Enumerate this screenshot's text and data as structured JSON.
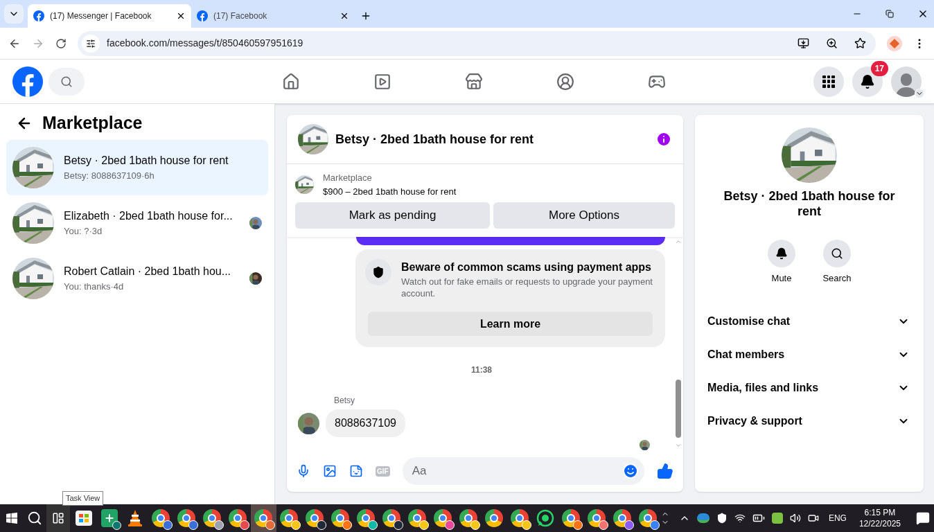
{
  "browser": {
    "tabs": [
      {
        "title": "(17) Messenger | Facebook",
        "selected": true
      },
      {
        "title": "(17) Facebook",
        "selected": false
      }
    ],
    "url": "facebook.com/messages/t/850460597951619"
  },
  "header": {
    "nav": [
      {
        "kind": "home"
      },
      {
        "kind": "video"
      },
      {
        "kind": "marketplace"
      },
      {
        "kind": "groups"
      },
      {
        "kind": "gaming"
      }
    ],
    "notifications_badge": "17"
  },
  "sidebar": {
    "title": "Marketplace",
    "chats": [
      {
        "name": "Betsy · 2bed 1bath house for rent",
        "preview": "Betsy: 8088637109·6h",
        "selected": true,
        "seen": false
      },
      {
        "name": "Elizabeth · 2bed 1bath house for...",
        "preview": "You: ?·3d",
        "selected": false,
        "seen": true
      },
      {
        "name": "Robert Catlain · 2bed 1bath hou...",
        "preview": "You: thanks·4d",
        "selected": false,
        "seen": true
      }
    ]
  },
  "chat": {
    "title": "Betsy · 2bed 1bath house for rent",
    "listing": {
      "label": "Marketplace",
      "text": "$900 – 2bed 1bath house for rent"
    },
    "actions": [
      "Mark as pending",
      "More Options"
    ],
    "notice": {
      "title": "Beware of common scams using payment apps",
      "body": "Watch out for fake emails or requests to upgrade your payment account.",
      "button": "Learn more"
    },
    "timestamp": "11:38",
    "messages": [
      {
        "sender": "Betsy",
        "text": "8088637109"
      }
    ],
    "composer": {
      "gif": "GIF",
      "placeholder": "Aa"
    }
  },
  "details": {
    "title": "Betsy · 2bed 1bath house for rent",
    "actions": [
      {
        "kind": "mute",
        "label": "Mute"
      },
      {
        "kind": "search",
        "label": "Search"
      }
    ],
    "sections": [
      {
        "label": "Customise chat",
        "expanded": false
      },
      {
        "label": "Chat members",
        "expanded": false
      },
      {
        "label": "Media, files and links",
        "expanded": false
      },
      {
        "label": "Privacy & support",
        "expanded": false
      }
    ]
  },
  "taskbar": {
    "tooltip": "Task View",
    "apps": [
      {
        "kind": "store"
      },
      {
        "kind": "sheets"
      },
      {
        "kind": "vlc"
      },
      {
        "kind": "chrome",
        "color": "#3b6fd8",
        "selected": false
      },
      {
        "kind": "chrome",
        "color": "#3b6fd8",
        "selected": false
      },
      {
        "kind": "chrome",
        "color": "#9ca3af",
        "selected": false
      },
      {
        "kind": "chrome",
        "color": "#e5484d",
        "selected": false
      },
      {
        "kind": "chrome",
        "color": "#e26b3a",
        "selected": true
      },
      {
        "kind": "chrome",
        "color": "#f5c518",
        "selected": false
      },
      {
        "kind": "chrome",
        "color": "#1f2937",
        "selected": false
      },
      {
        "kind": "chrome",
        "color": "#f97316",
        "selected": false
      },
      {
        "kind": "chrome",
        "color": "#14b8a6",
        "selected": false
      },
      {
        "kind": "chrome",
        "color": "#1f2937",
        "selected": false
      },
      {
        "kind": "chrome",
        "color": "#f5c518",
        "selected": false
      },
      {
        "kind": "chrome",
        "color": "#ec4899",
        "selected": false
      },
      {
        "kind": "chrome",
        "color": "#f5c518",
        "selected": false
      },
      {
        "kind": "chrome-plain",
        "selected": false
      },
      {
        "kind": "chrome",
        "color": "#f5c518",
        "selected": false
      },
      {
        "kind": "whatsapp"
      },
      {
        "kind": "chrome",
        "color": "#f97316",
        "selected": false
      },
      {
        "kind": "chrome",
        "color": "#f87171",
        "selected": false
      },
      {
        "kind": "chrome",
        "color": "#8b5cf6",
        "selected": false
      },
      {
        "kind": "chrome",
        "color": "#3b82f6",
        "selected": false
      }
    ],
    "language": "ENG",
    "time": "6:15 PM",
    "date": "12/22/2025"
  }
}
